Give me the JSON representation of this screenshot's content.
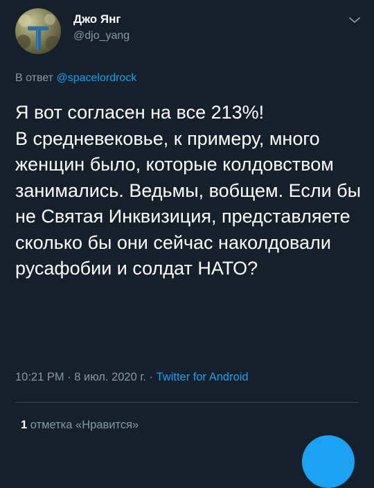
{
  "author": {
    "display_name": "Джо Янг",
    "handle": "@djo_yang",
    "avatar_icon": "avatar-image"
  },
  "reply": {
    "prefix": "В ответ",
    "mention": "@spacelordrock"
  },
  "tweet_text": "Я вот согласен на все 213%!\nВ средневековье, к примеру, много женщин было, которые колдовством занимались. Ведьмы, вобщем. Если бы не Святая Инквизиция, представляете сколько бы они сейчас наколдовали русафобии и солдат НАТО?",
  "meta": {
    "time_date": "10:21 PM · 8 июл. 2020 г. ·",
    "source": "Twitter for Android"
  },
  "likes": {
    "count": "1",
    "label": "отметка «Нравится»"
  },
  "colors": {
    "background": "#15202b",
    "accent": "#1da1f2",
    "secondary_text": "#8899a6",
    "divider": "#38444d"
  }
}
